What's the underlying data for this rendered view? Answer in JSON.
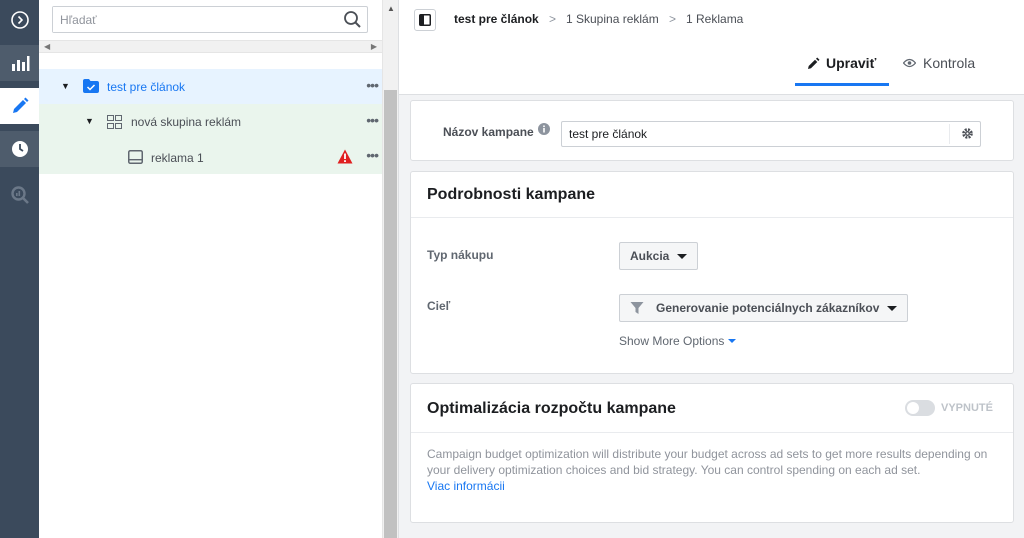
{
  "search": {
    "placeholder": "Hľadať"
  },
  "tree": {
    "items": [
      {
        "label": "test pre článok"
      },
      {
        "label": "nová skupina reklám"
      },
      {
        "label": "reklama 1"
      }
    ]
  },
  "breadcrumb": {
    "campaign": "test pre článok",
    "adset": "1 Skupina reklám",
    "ad": "1 Reklama"
  },
  "tabs": {
    "edit": "Upraviť",
    "review": "Kontrola"
  },
  "campaign_name": {
    "label": "Názov kampane",
    "value": "test pre článok"
  },
  "details": {
    "title": "Podrobnosti kampane",
    "buying_type_label": "Typ nákupu",
    "buying_type_value": "Aukcia",
    "objective_label": "Cieľ",
    "objective_value": "Generovanie potenciálnych zákazníkov",
    "show_more": "Show More Options"
  },
  "budget": {
    "title": "Optimalizácia rozpočtu kampane",
    "toggle_label": "VYPNUTÉ",
    "description": "Campaign budget optimization will distribute your budget across ad sets to get more results depending on your delivery optimization choices and bid strategy. You can control spending on each ad set.",
    "learn_more": "Viac informácii"
  },
  "colors": {
    "accent": "#1877f2",
    "rail": "#3b4a5c",
    "warning": "#e02020",
    "link": "#385898"
  }
}
